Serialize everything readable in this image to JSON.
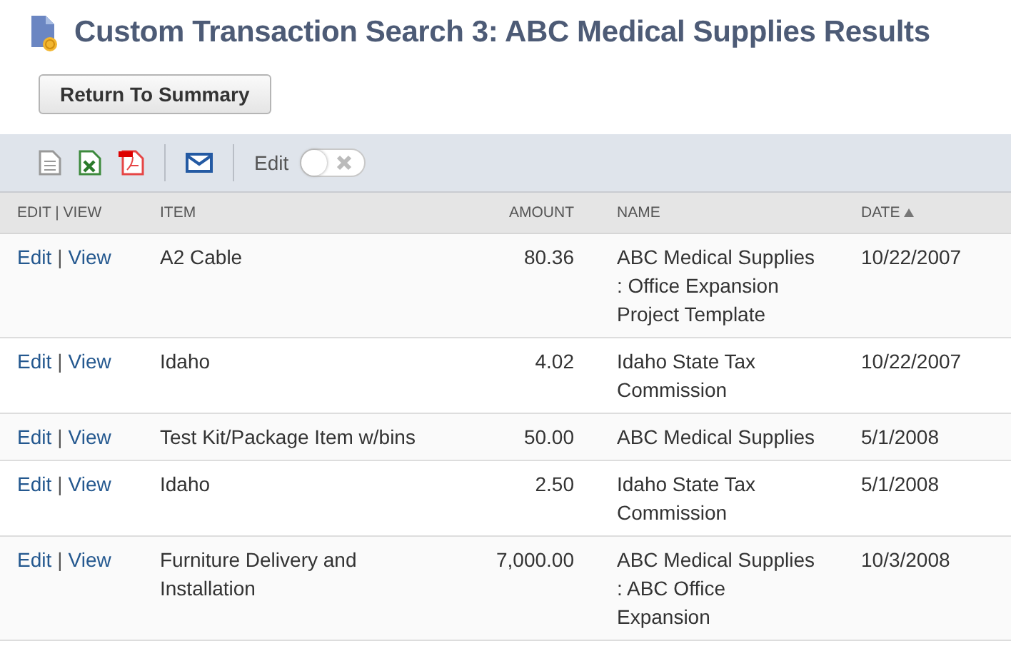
{
  "page": {
    "title": "Custom Transaction Search 3: ABC Medical Supplies Results"
  },
  "buttons": [
    "Return To Summary"
  ],
  "toolbar": {
    "edit_label": "Edit",
    "edit_on": false
  },
  "table": {
    "columns": [
      {
        "label": "EDIT | VIEW",
        "sorted": false
      },
      {
        "label": "ITEM",
        "sorted": false
      },
      {
        "label": "AMOUNT",
        "sorted": false
      },
      {
        "label": "NAME",
        "sorted": false
      },
      {
        "label": "DATE",
        "sorted": true
      }
    ],
    "rows": [
      {
        "edit": "Edit",
        "sep": "|",
        "view": "View",
        "item": "A2 Cable",
        "amount": "80.36",
        "name": "ABC Medical Supplies : Office Expansion Project Template",
        "date": "10/22/2007"
      },
      {
        "edit": "Edit",
        "sep": "|",
        "view": "View",
        "item": "Idaho",
        "amount": "4.02",
        "name": "Idaho State Tax Commission",
        "date": "10/22/2007"
      },
      {
        "edit": "Edit",
        "sep": "|",
        "view": "View",
        "item": "Test Kit/Package Item w/bins",
        "amount": "50.00",
        "name": "ABC Medical Supplies",
        "date": "5/1/2008"
      },
      {
        "edit": "Edit",
        "sep": "|",
        "view": "View",
        "item": "Idaho",
        "amount": "2.50",
        "name": "Idaho State Tax Commission",
        "date": "5/1/2008"
      },
      {
        "edit": "Edit",
        "sep": "|",
        "view": "View",
        "item": "Furniture Delivery and Installation",
        "amount": "7,000.00",
        "name": "ABC Medical Supplies : ABC Office Expansion",
        "date": "10/3/2008"
      }
    ]
  }
}
